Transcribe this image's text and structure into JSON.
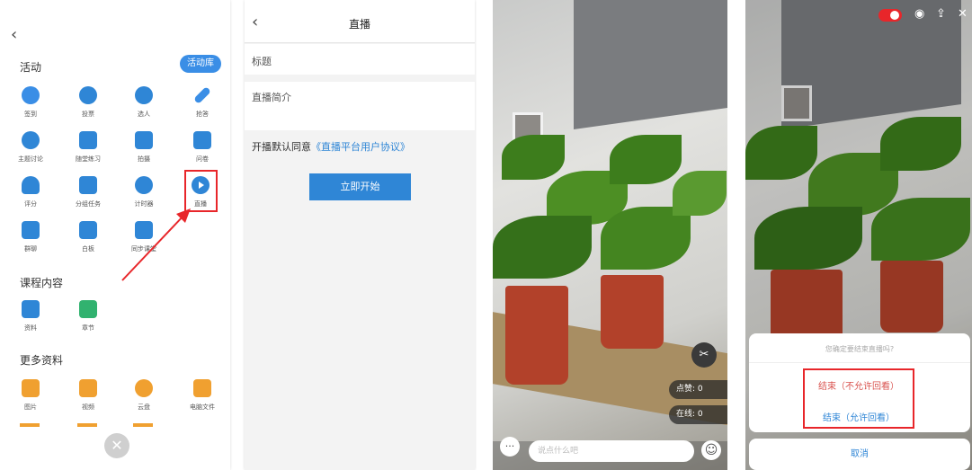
{
  "panel1": {
    "activities_title": "活动",
    "library_button": "活动库",
    "activities": [
      {
        "label": "签到",
        "icon": "hand-tap-icon"
      },
      {
        "label": "投票",
        "icon": "bar-chart-icon"
      },
      {
        "label": "选人",
        "icon": "person-select-icon"
      },
      {
        "label": "抢答",
        "icon": "microphone-icon"
      },
      {
        "label": "主题讨论",
        "icon": "chat-bubble-icon"
      },
      {
        "label": "随堂练习",
        "icon": "exercise-icon"
      },
      {
        "label": "拍摄",
        "icon": "camera-icon"
      },
      {
        "label": "问卷",
        "icon": "questionnaire-icon"
      },
      {
        "label": "评分",
        "icon": "rating-icon"
      },
      {
        "label": "分组任务",
        "icon": "group-task-icon"
      },
      {
        "label": "计时器",
        "icon": "timer-icon"
      },
      {
        "label": "直播",
        "icon": "play-circle-icon"
      },
      {
        "label": "群聊",
        "icon": "group-chat-icon"
      },
      {
        "label": "白板",
        "icon": "whiteboard-icon"
      },
      {
        "label": "同步课堂",
        "icon": "sync-class-icon"
      }
    ],
    "course_title": "课程内容",
    "course": [
      {
        "label": "资料",
        "icon": "folder-icon"
      },
      {
        "label": "章节",
        "icon": "chapter-icon"
      }
    ],
    "more_title": "更多资料",
    "more": [
      {
        "label": "图片",
        "icon": "image-icon"
      },
      {
        "label": "视频",
        "icon": "video-icon"
      },
      {
        "label": "云盘",
        "icon": "cloud-icon"
      },
      {
        "label": "电脑文件",
        "icon": "computer-icon"
      }
    ],
    "close_symbol": "✕",
    "back_symbol": "‹"
  },
  "panel2": {
    "back_symbol": "‹",
    "title": "直播",
    "field_title": "标题",
    "field_intro": "直播简介",
    "agree_prefix": "开播默认同意",
    "agree_link": "《直播平台用户协议》",
    "start_button": "立即开始"
  },
  "panel3": {
    "likes_label": "点赞: 0",
    "online_label": "在线: 0",
    "say_placeholder": "说点什么吧",
    "msg_symbol": "···",
    "emoji_symbol": "☺",
    "clip_symbol": "✂"
  },
  "panel4": {
    "question": "您确定要结束直播吗?",
    "option_no_replay": "结束（不允许回看）",
    "option_replay": "结束（允许回看）",
    "cancel": "取消"
  },
  "colors": {
    "accent_blue": "#2f86d6",
    "highlight_red": "#e8262a",
    "danger_text": "#d9534f"
  }
}
